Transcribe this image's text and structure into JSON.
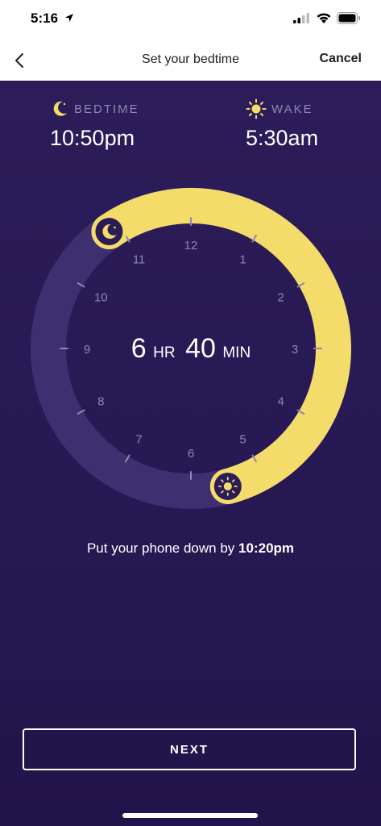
{
  "status_bar": {
    "time": "5:16"
  },
  "nav": {
    "title": "Set your bedtime",
    "cancel": "Cancel"
  },
  "bedtime": {
    "label": "BEDTIME",
    "value": "10:50pm",
    "icon": "moon-icon"
  },
  "wake": {
    "label": "WAKE",
    "value": "5:30am",
    "icon": "sun-icon"
  },
  "dial": {
    "numbers": [
      "12",
      "1",
      "2",
      "3",
      "4",
      "5",
      "6",
      "7",
      "8",
      "9",
      "10",
      "11"
    ],
    "duration_hours": "6",
    "hr_unit": "HR",
    "duration_minutes": "40",
    "min_unit": "MIN",
    "start_hour": 22.833,
    "end_hour": 5.5,
    "arc_color": "#f3dc6a",
    "track_color": "#3e3070"
  },
  "phone_down": {
    "prefix": "Put your phone down by",
    "time": "10:20pm"
  },
  "next_button": {
    "label": "NEXT"
  }
}
